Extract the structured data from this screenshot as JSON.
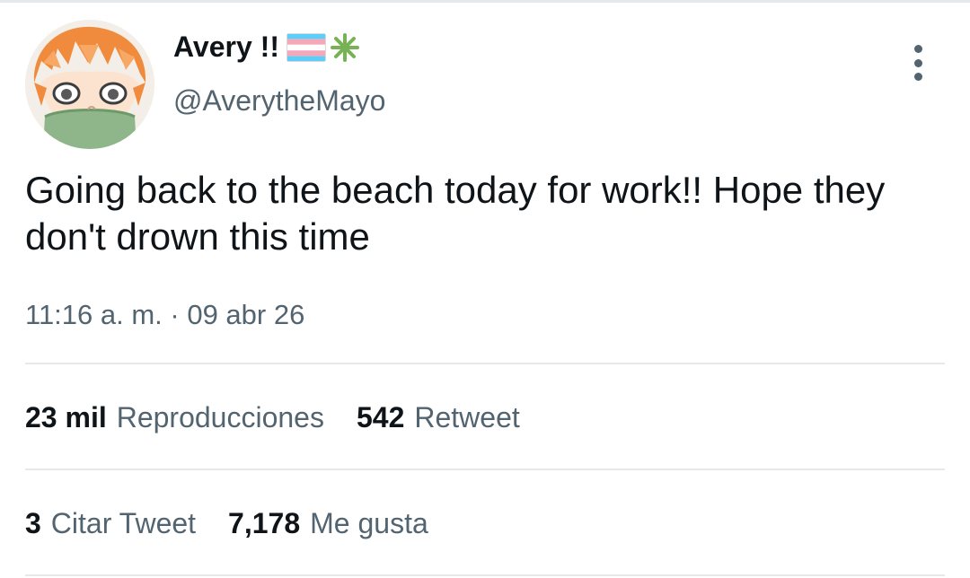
{
  "user": {
    "display_name": "Avery !!",
    "handle": "@AverytheMayo",
    "name_emojis": [
      "transgender-flag-emoji",
      "sparkle-emoji"
    ]
  },
  "tweet": {
    "text": "Going back to the beach today for work!! Hope they don't drown this time",
    "timestamp": "11:16 a. m. · 09 abr 26"
  },
  "stats_row_1": [
    {
      "count": "23 mil",
      "label": "Reproducciones"
    },
    {
      "count": "542",
      "label": "Retweet"
    }
  ],
  "stats_row_2": [
    {
      "count": "3",
      "label": "Citar Tweet"
    },
    {
      "count": "7,178",
      "label": "Me gusta"
    }
  ],
  "colors": {
    "text_primary": "#0f1419",
    "text_secondary": "#536471",
    "divider": "#e6e9ec",
    "flag_blue": "#5bcefa",
    "flag_pink": "#f5a9b8",
    "sparkle_green": "#77b255"
  },
  "icons": {
    "more": "vertical-ellipsis-icon"
  }
}
